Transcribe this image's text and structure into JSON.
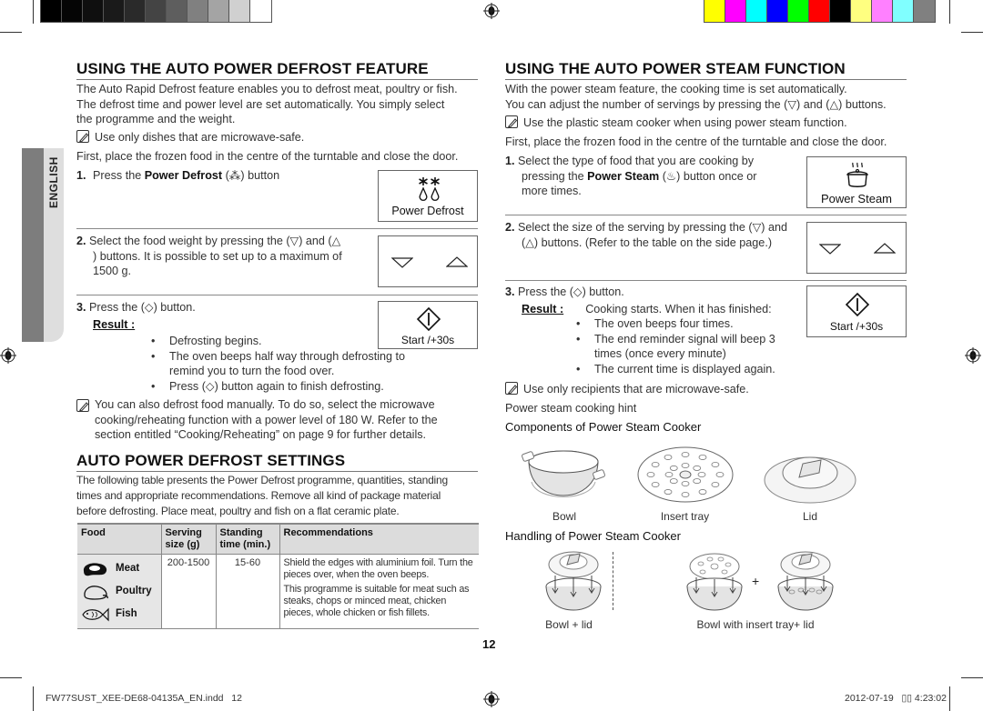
{
  "print_marks": {
    "gray_swatches": [
      "#000000",
      "#050505",
      "#0f0f0f",
      "#1a1a1a",
      "#2a2a2a",
      "#444444",
      "#5e5e5e",
      "#808080",
      "#a4a4a4",
      "#d0d0d0",
      "#ffffff"
    ],
    "color_swatches": [
      "#ffff00",
      "#ff00ff",
      "#00ffff",
      "#0000ff",
      "#00ff00",
      "#ff0000",
      "#000000",
      "#ffff80",
      "#ff80ff",
      "#80ffff",
      "#808080"
    ]
  },
  "sidebar": {
    "language": "ENGLISH"
  },
  "left": {
    "title": "USING THE AUTO POWER DEFROST FEATURE",
    "intro": [
      "The Auto Rapid Defrost feature enables you to defrost meat, poultry or fish.",
      "The defrost time and power level are set automatically. You simply select",
      "the programme and the weight."
    ],
    "note1": "Use only dishes that are microwave-safe.",
    "first": "First, place the frozen food in the centre of the turntable and close the door.",
    "step1": {
      "num": "1.",
      "pre": "Press the ",
      "bold": "Power Defrost",
      "post": " (⁂) button"
    },
    "step2": {
      "num": "2.",
      "lines": [
        "Select the food weight by pressing the (▽) and (△",
        ") buttons. It is possible to set up to a maximum of",
        "1500 g."
      ]
    },
    "step3": {
      "num": "3.",
      "text": "Press the (◇) button.",
      "result_label": "Result :",
      "bullets": [
        "Defrosting begins.",
        "The oven beeps half way through defrosting to remind you to turn the food over.",
        "Press (◇) button again to finish defrosting."
      ]
    },
    "note2": [
      "You can also defrost food manually. To do so, select the microwave",
      "cooking/reheating function with a power level of 180 W. Refer to the",
      "section entitled “Cooking/Reheating” on page 9 for further details."
    ],
    "panels": {
      "defrost_label": "Power Defrost",
      "start_label": "Start /+30s"
    },
    "settings": {
      "title": "AUTO POWER DEFROST SETTINGS",
      "intro": [
        "The following table presents the Power Defrost programme, quantities, standing",
        "times and appropriate recommendations. Remove all kind of package material",
        "before defrosting. Place meat, poultry and fish on a flat ceramic plate."
      ],
      "table": {
        "headers": [
          "Food",
          "Serving size (g)",
          "Standing time (min.)",
          "Recommendations"
        ],
        "foods": [
          "Meat",
          "Poultry",
          "Fish"
        ],
        "serving": "200-1500",
        "standing": "15-60",
        "recommendations": [
          "Shield the edges with aluminium foil. Turn the pieces over, when the oven beeps.",
          "This programme is suitable for meat such as steaks, chops or minced meat, chicken pieces, whole chicken or fish fillets."
        ]
      }
    }
  },
  "right": {
    "title": "USING THE AUTO POWER STEAM FUNCTION",
    "intro": [
      "With the power steam feature, the cooking time is set automatically.",
      "You can adjust the number of servings by pressing the (▽) and (△) buttons."
    ],
    "note1": "Use the plastic steam cooker when using power steam function.",
    "first": "First, place the frozen food in the centre of the turntable and close the door.",
    "step1": {
      "num": "1.",
      "line1": "Select the type of food that you are cooking by",
      "pre": "pressing the ",
      "bold": "Power Steam",
      "post": " (♨) button once or",
      "line3": "more times."
    },
    "step2": {
      "num": "2.",
      "lines": [
        "Select the size of the serving by pressing the (▽) and",
        "(△) buttons. (Refer to the table on the side page.)"
      ]
    },
    "step3": {
      "num": "3.",
      "text": "Press the (◇) button.",
      "result_label": "Result :",
      "result_text": "Cooking starts. When it has finished:",
      "bullets": [
        "The oven beeps four times.",
        "The end reminder signal will beep 3 times (once every minute)",
        "The current time is displayed again."
      ]
    },
    "note2": "Use only recipients that are microwave-safe.",
    "hint": "Power steam cooking hint",
    "panels": {
      "steam_label": "Power Steam",
      "start_label": "Start /+30s"
    },
    "components": {
      "title": "Components of Power Steam Cooker",
      "items": [
        "Bowl",
        "Insert tray",
        "Lid"
      ]
    },
    "handling": {
      "title": "Handling of Power Steam Cooker",
      "items": [
        "Bowl + lid",
        "Bowl with insert tray+ lid"
      ],
      "plus": "+"
    }
  },
  "page_number": "12",
  "footer": {
    "file": "FW77SUST_XEE-DE68-04135A_EN.indd   12",
    "timestamp": "2012-07-19   ▯▯ 4:23:02"
  }
}
